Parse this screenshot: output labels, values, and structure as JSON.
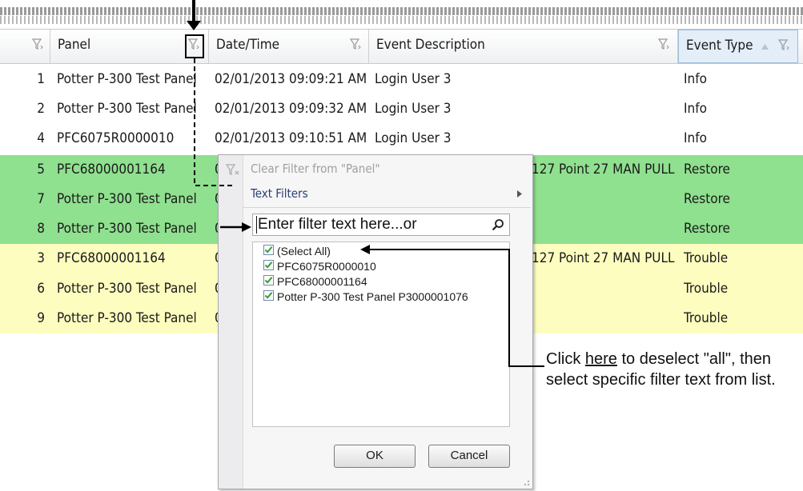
{
  "colors": {
    "green_row": "#8fe08f",
    "yellow_row": "#fdfdc0",
    "header_sorted": "#e3eef9",
    "arrow": "#000000"
  },
  "columns": [
    {
      "label": ""
    },
    {
      "label": "Panel"
    },
    {
      "label": "Date/Time"
    },
    {
      "label": "Event Description"
    },
    {
      "label": "Event Type"
    }
  ],
  "rows": [
    {
      "num": "1",
      "panel": "Potter P-300 Test Panel",
      "datetime": "02/01/2013 09:09:21 AM",
      "description": "Login User 3",
      "type": "Info",
      "status": "info"
    },
    {
      "num": "2",
      "panel": "Potter P-300 Test Panel",
      "datetime": "02/01/2013 09:09:32 AM",
      "description": "Login User 3",
      "type": "Info",
      "status": "info"
    },
    {
      "num": "4",
      "panel": "PFC6075R0000010",
      "datetime": "02/01/2013 09:10:51 AM",
      "description": "Login User 3",
      "type": "Info",
      "status": "info"
    },
    {
      "num": "5",
      "panel": "PFC68000001164",
      "datetime": "0",
      "description": "127 Point 27 MAN PULL",
      "type": "Restore",
      "status": "restore"
    },
    {
      "num": "7",
      "panel": "Potter P-300 Test Panel",
      "datetime": "0",
      "description": "",
      "type": "Restore",
      "status": "restore"
    },
    {
      "num": "8",
      "panel": "Potter P-300 Test Panel",
      "datetime": "0",
      "description": "",
      "type": "Restore",
      "status": "restore"
    },
    {
      "num": "3",
      "panel": "PFC68000001164",
      "datetime": "0",
      "description": "127 Point 27 MAN PULL",
      "type": "Trouble",
      "status": "trouble"
    },
    {
      "num": "6",
      "panel": "Potter P-300 Test Panel",
      "datetime": "0",
      "description": "",
      "type": "Trouble",
      "status": "trouble"
    },
    {
      "num": "9",
      "panel": "Potter P-300 Test Panel",
      "datetime": "0",
      "description": "",
      "type": "Trouble",
      "status": "trouble"
    }
  ],
  "filter_popup": {
    "clear_filter": "Clear Filter from \"Panel\"",
    "text_filters": "Text Filters",
    "search_placeholder": "Enter filter text here...or",
    "items": [
      {
        "label": "(Select All)",
        "checked": true
      },
      {
        "label": "PFC6075R0000010",
        "checked": true
      },
      {
        "label": "PFC68000001164",
        "checked": true
      },
      {
        "label": "Potter P-300 Test Panel P3000001076",
        "checked": true
      }
    ],
    "ok_label": "OK",
    "cancel_label": "Cancel"
  },
  "callout": {
    "prefix": "Click ",
    "link": "here",
    "suffix": " to deselect \"all\", then select specific filter text from list."
  },
  "icons": [
    "filter-icon",
    "clear-filter-icon",
    "search-icon",
    "checkbox-checked-icon",
    "submenu-arrow-icon",
    "sort-ascending-icon",
    "resize-grip-icon"
  ]
}
